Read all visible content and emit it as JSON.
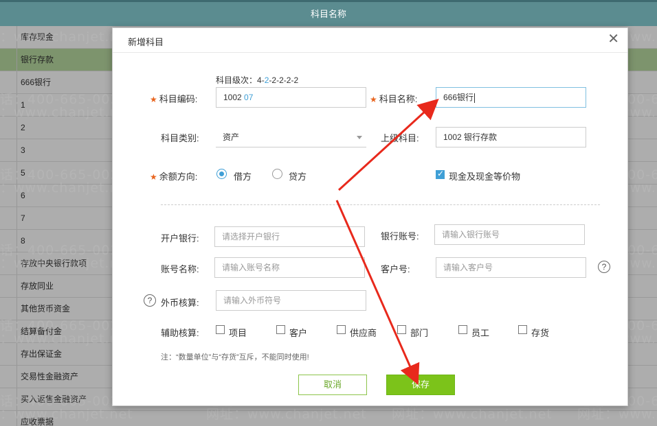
{
  "page": {
    "header_title": "科目名称",
    "list_items": [
      "库存现金",
      "银行存款",
      "666银行",
      "1",
      "2",
      "3",
      "5",
      "6",
      "7",
      "8",
      "存放中央银行款项",
      "存放同业",
      "其他货币资金",
      "结算备付金",
      "存出保证金",
      "交易性金融资产",
      "买入返售金融资产",
      "应收票据"
    ],
    "selected_index": 1
  },
  "watermark": {
    "phone": "电话：400-665-0028",
    "site": "网址：www.chanjet.net"
  },
  "dialog": {
    "title": "新增科目",
    "close_symbol": "✕",
    "level_label": "科目级次：",
    "level_value": "4-2-2-2-2-2",
    "code_label": "科目编码:",
    "code_prefix": "1002",
    "code_suffix": "07",
    "name_label": "科目名称:",
    "name_value": "666银行",
    "category_label": "科目类别:",
    "category_value": "资产",
    "parent_label": "上级科目:",
    "parent_value": "1002 银行存款",
    "direction_label": "余额方向:",
    "debit_label": "借方",
    "credit_label": "贷方",
    "cash_equiv_label": "现金及现金等价物",
    "bank_label": "开户银行:",
    "bank_placeholder": "请选择开户银行",
    "account_no_label": "银行账号:",
    "account_no_placeholder": "请输入银行账号",
    "account_name_label": "账号名称:",
    "account_name_placeholder": "请输入账号名称",
    "customer_no_label": "客户号:",
    "customer_no_placeholder": "请输入客户号",
    "currency_label": "外币核算:",
    "currency_placeholder": "请输入外币符号",
    "aux_label": "辅助核算:",
    "aux_items": [
      "项目",
      "客户",
      "供应商",
      "部门",
      "员工",
      "存货"
    ],
    "note": "注：“数量单位”与“存货”互斥，不能同时使用!",
    "cancel_label": "取消",
    "save_label": "保存",
    "help_symbol": "?",
    "required_mark": "★"
  },
  "colors": {
    "accent": "#3f9fd6",
    "save_green": "#7cc31a",
    "arrow_red": "#e8291c",
    "header_teal": "#5b8c90",
    "selected_row": "#b9dba1"
  }
}
